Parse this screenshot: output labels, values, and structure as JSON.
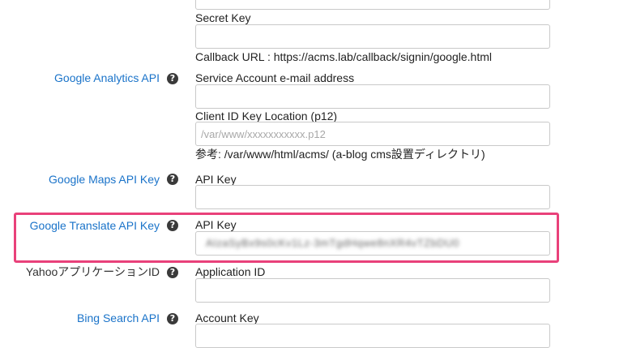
{
  "top_partial_input": {
    "value": ""
  },
  "google_signin": {
    "secret_key_label": "Secret Key",
    "secret_key_value": "",
    "callback_note": "Callback URL : https://acms.lab/callback/signin/google.html"
  },
  "google_analytics": {
    "label": "Google Analytics API",
    "service_account_label": "Service Account e-mail address",
    "service_account_value": "",
    "client_id_label": "Client ID Key Location (p12)",
    "client_id_placeholder": "/var/www/xxxxxxxxxxx.p12",
    "reference_note": "参考: /var/www/html/acms/ (a-blog cms設置ディレクトリ)"
  },
  "google_maps": {
    "label": "Google Maps API Key",
    "api_key_label": "API Key",
    "api_key_value": ""
  },
  "google_translate": {
    "label": "Google Translate API Key",
    "api_key_label": "API Key",
    "api_key_value_blurred": "AIzaSyBx9s0cKv1Lz-3mTgdHqwe8nXR4vTZbDU0"
  },
  "yahoo": {
    "label": "YahooアプリケーションID",
    "app_id_label": "Application ID",
    "app_id_value": ""
  },
  "bing": {
    "label": "Bing Search API",
    "account_key_label": "Account Key",
    "account_key_value": ""
  },
  "help_glyph": "?",
  "colors": {
    "link": "#1a73c9",
    "highlight": "#e9417a",
    "help_icon": "#3a3a3a"
  }
}
